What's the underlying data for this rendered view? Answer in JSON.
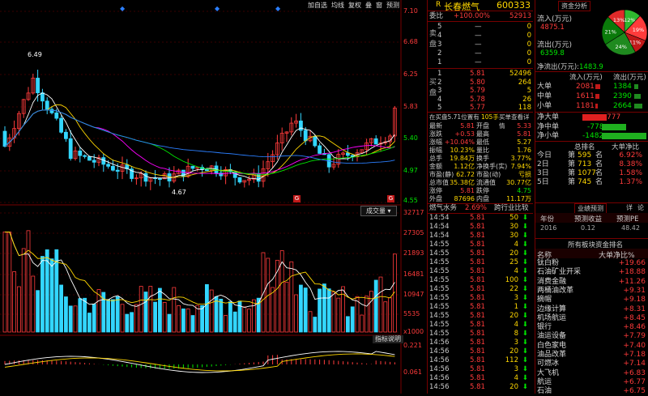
{
  "toolbar": {
    "items": [
      "加自选",
      "均线",
      "复权",
      "叠",
      "窗",
      "预测"
    ]
  },
  "price_axis": [
    "7.10",
    "6.68",
    "6.25",
    "5.83",
    "5.40",
    "4.97",
    "4.55"
  ],
  "price_labels": {
    "high": "6.49",
    "low": "4.67"
  },
  "volume_label": "成交量",
  "volume_axis": [
    "32717",
    "27305",
    "21893",
    "16481",
    "10947",
    "5535",
    "x1000"
  ],
  "indicator_label": "指标说明",
  "macd_axis": [
    "0.221",
    "0.061"
  ],
  "stock": {
    "code_mark": "R",
    "name": "长春燃气",
    "code": "600333"
  },
  "weibi": {
    "label": "委比",
    "value": "+100.00%",
    "num": "52913"
  },
  "sell_label": "卖盘",
  "buy_label": "买盘",
  "sell": [
    {
      "n": "5",
      "p": "—",
      "v": "0"
    },
    {
      "n": "4",
      "p": "—",
      "v": "0"
    },
    {
      "n": "3",
      "p": "—",
      "v": "0"
    },
    {
      "n": "2",
      "p": "—",
      "v": "0"
    },
    {
      "n": "1",
      "p": "—",
      "v": "0"
    }
  ],
  "buy": [
    {
      "n": "1",
      "p": "5.81",
      "v": "52496"
    },
    {
      "n": "2",
      "p": "5.80",
      "v": "264"
    },
    {
      "n": "3",
      "p": "5.79",
      "v": "5"
    },
    {
      "n": "4",
      "p": "5.78",
      "v": "26"
    },
    {
      "n": "5",
      "p": "5.77",
      "v": "118"
    }
  ],
  "queue": {
    "text": "在买盘5.71位置有",
    "count": "105手",
    "link": "买单查看详情"
  },
  "stats": [
    {
      "l1": "最新",
      "v1": "5.81",
      "l2": "开盘",
      "v2": "5.33"
    },
    {
      "l1": "涨跌",
      "v1": "+0.53",
      "l2": "最高",
      "v2": "5.81"
    },
    {
      "l1": "涨幅",
      "v1": "+10.04%",
      "l2": "最低",
      "v2": "5.27"
    },
    {
      "l1": "振幅",
      "v1": "10.23%",
      "l2": "量比",
      "v2": "1.76"
    },
    {
      "l1": "总手",
      "v1": "19.84万",
      "l2": "换手",
      "v2": "3.77%"
    },
    {
      "l1": "金额",
      "v1": "1.12亿",
      "l2": "净换手(实)",
      "v2": "7.94%"
    },
    {
      "l1": "市盈(静)",
      "v1": "62.72",
      "l2": "市盈(动)",
      "v2": "亏损"
    },
    {
      "l1": "总市值",
      "v1": "35.38亿",
      "l2": "流通值",
      "v2": "30.77亿"
    },
    {
      "l1": "涨停",
      "v1": "5.81",
      "l2": "跌停",
      "v2": "4.75"
    },
    {
      "l1": "外盘",
      "v1": "87696",
      "l2": "内盘",
      "v2": "11.17万"
    }
  ],
  "tabs": {
    "t1": "燃气水务",
    "t1v": "2.69%",
    "t2": "跨行业比较"
  },
  "ticks": [
    {
      "t": "14:54",
      "p": "5.81",
      "v": "50"
    },
    {
      "t": "14:54",
      "p": "5.81",
      "v": "30"
    },
    {
      "t": "14:54",
      "p": "5.81",
      "v": "30"
    },
    {
      "t": "14:55",
      "p": "5.81",
      "v": "4"
    },
    {
      "t": "14:55",
      "p": "5.81",
      "v": "20"
    },
    {
      "t": "14:55",
      "p": "5.81",
      "v": "25"
    },
    {
      "t": "14:55",
      "p": "5.81",
      "v": "4"
    },
    {
      "t": "14:55",
      "p": "5.81",
      "v": "100"
    },
    {
      "t": "14:55",
      "p": "5.81",
      "v": "22"
    },
    {
      "t": "14:55",
      "p": "5.81",
      "v": "3"
    },
    {
      "t": "14:55",
      "p": "5.81",
      "v": "1"
    },
    {
      "t": "14:55",
      "p": "5.81",
      "v": "20"
    },
    {
      "t": "14:55",
      "p": "5.81",
      "v": "4"
    },
    {
      "t": "14:55",
      "p": "5.81",
      "v": "8"
    },
    {
      "t": "14:56",
      "p": "5.81",
      "v": "3"
    },
    {
      "t": "14:56",
      "p": "5.81",
      "v": "20"
    },
    {
      "t": "14:56",
      "p": "5.81",
      "v": "112"
    },
    {
      "t": "14:56",
      "p": "5.81",
      "v": "3"
    },
    {
      "t": "14:56",
      "p": "5.81",
      "v": "4"
    },
    {
      "t": "14:56",
      "p": "5.81",
      "v": "20"
    }
  ],
  "fund": {
    "tab": "资金分析",
    "in_label": "流入(万元)",
    "in_value": "4875.1",
    "out_label": "流出(万元)",
    "out_value": "6359.8",
    "net_label": "净流出(万元):",
    "net_value": "1483.9",
    "pie": [
      {
        "label": "12%",
        "v": 12,
        "color": "#2fb82f"
      },
      {
        "label": "19%",
        "v": 19,
        "color": "#ff3b3b"
      },
      {
        "label": "11%",
        "v": 11,
        "color": "#c01818"
      },
      {
        "label": "24%",
        "v": 24,
        "color": "#1f8a1f"
      },
      {
        "label": "21%",
        "v": 21,
        "color": "#0a7a0a"
      },
      {
        "label": "13%",
        "v": 13,
        "color": "#e12a2a"
      }
    ]
  },
  "flow_header": {
    "h1": "流入(万元)",
    "h2": "流出(万元)"
  },
  "flow": [
    {
      "l": "大单",
      "in": "2081",
      "out": "1384",
      "fin": 0.6,
      "fout": 0.4
    },
    {
      "l": "中单",
      "in": "1611",
      "out": "2390",
      "fin": 0.45,
      "fout": 0.7
    },
    {
      "l": "小单",
      "in": "1181",
      "out": "2664",
      "fin": 0.3,
      "fout": 0.8
    }
  ],
  "netbars": [
    {
      "l": "净大单",
      "v": "777",
      "d": "up",
      "f": 0.3
    },
    {
      "l": "净中单",
      "v": "-778",
      "d": "down",
      "f": 0.3
    },
    {
      "l": "净小单",
      "v": "-1482",
      "d": "down",
      "f": 0.55
    }
  ],
  "rank_header": {
    "h1": "总排名",
    "h2": "大单净比"
  },
  "rank": [
    {
      "d": "今日",
      "pre": "第",
      "n": "595",
      "suf": "名",
      "v": "6.92%"
    },
    {
      "d": "2日",
      "pre": "第",
      "n": "713",
      "suf": "名",
      "v": "8.38%"
    },
    {
      "d": "3日",
      "pre": "第",
      "n": "1077",
      "suf": "名",
      "v": "1.58%"
    },
    {
      "d": "5日",
      "pre": "第",
      "n": "745",
      "suf": "名",
      "v": "1.37%"
    }
  ],
  "forecast": {
    "tab": "业绩预测",
    "link1": "详",
    "link2": "论",
    "h": [
      "年份",
      "预测收益",
      "预测PE"
    ],
    "row": [
      "2016",
      "0.12",
      "48.42"
    ]
  },
  "sector": {
    "title": "所有板块资金排名",
    "h1": "名称",
    "h2": "大单净比%",
    "items": [
      {
        "n": "钛白粉",
        "v": "+19.66"
      },
      {
        "n": "石油矿业开采",
        "v": "+18.88"
      },
      {
        "n": "消费金融",
        "v": "+11.26"
      },
      {
        "n": "两桶油改革",
        "v": "+9.31"
      },
      {
        "n": "摘帽",
        "v": "+9.18"
      },
      {
        "n": "边缘计算",
        "v": "+8.31"
      },
      {
        "n": "机场航运",
        "v": "+8.45"
      },
      {
        "n": "银行",
        "v": "+8.46"
      },
      {
        "n": "油运设备",
        "v": "+7.79"
      },
      {
        "n": "白色家电",
        "v": "+7.40"
      },
      {
        "n": "油品改革",
        "v": "+7.18"
      },
      {
        "n": "可燃冰",
        "v": "+7.14"
      },
      {
        "n": "大飞机",
        "v": "+6.83"
      },
      {
        "n": "航运",
        "v": "+6.77"
      },
      {
        "n": "石油",
        "v": "+6.75"
      }
    ]
  }
}
